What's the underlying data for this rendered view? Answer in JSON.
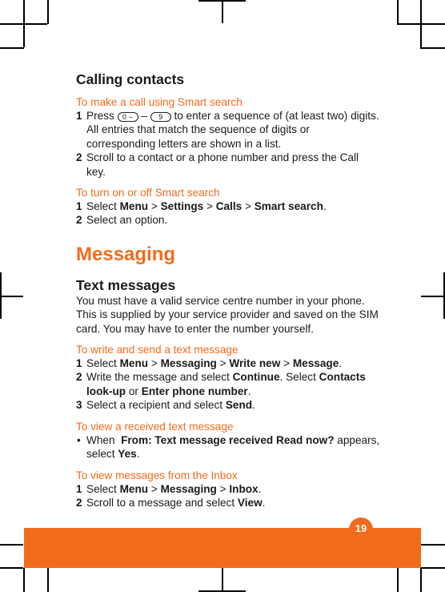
{
  "page": {
    "page_number": "19",
    "accent_color": "#f26b1d"
  },
  "calling": {
    "title": "Calling contacts",
    "smart_call": {
      "subtitle": "To make a call using Smart search",
      "steps": [
        {
          "num": "1",
          "pre": "Press",
          "key_start": "0 ⌣",
          "dash": "–",
          "key_end": "9",
          "post": "to enter a sequence of (at least two) digits. All entries that match the sequence of digits or corresponding letters are shown in a list."
        },
        {
          "num": "2",
          "text": "Scroll to a contact or a phone number and press the Call key."
        }
      ]
    },
    "toggle": {
      "subtitle": "To turn on or off Smart search",
      "steps": [
        {
          "num": "1",
          "pre": "Select",
          "p1": "Menu",
          "sep": ">",
          "p2": "Settings",
          "p3": "Calls",
          "p4": "Smart search",
          "end": "."
        },
        {
          "num": "2",
          "text": "Select an option."
        }
      ]
    }
  },
  "messaging": {
    "title": "Messaging",
    "text_messages": {
      "title": "Text messages",
      "intro": "You must have a valid service centre number in your phone. This is supplied by your service provider and saved on the SIM card. You may have to enter the number yourself."
    },
    "write": {
      "subtitle": "To write and send a text message",
      "steps": [
        {
          "num": "1",
          "pre": "Select",
          "p1": "Menu",
          "sep": ">",
          "p2": "Messaging",
          "p3": "Write new",
          "p4": "Message",
          "end": "."
        },
        {
          "num": "2",
          "pre": "Write the message and select",
          "b1": "Continue",
          "mid": ". Select",
          "b2": "Contacts look-up",
          "or": "or",
          "b3": "Enter phone number",
          "end": "."
        },
        {
          "num": "3",
          "pre": "Select a recipient and select",
          "b1": "Send",
          "end": "."
        }
      ]
    },
    "received": {
      "subtitle": "To view a received text message",
      "bullet": "•",
      "pre": "When",
      "bold": "From:  Text message received Read now?",
      "post": "appears, select",
      "b2": "Yes",
      "end": "."
    },
    "inbox": {
      "subtitle": "To view messages from the Inbox",
      "steps": [
        {
          "num": "1",
          "pre": "Select",
          "p1": "Menu",
          "sep": ">",
          "p2": "Messaging",
          "p3": "Inbox",
          "end": "."
        },
        {
          "num": "2",
          "pre": "Scroll to a message and select",
          "b1": "View",
          "end": "."
        }
      ]
    }
  }
}
